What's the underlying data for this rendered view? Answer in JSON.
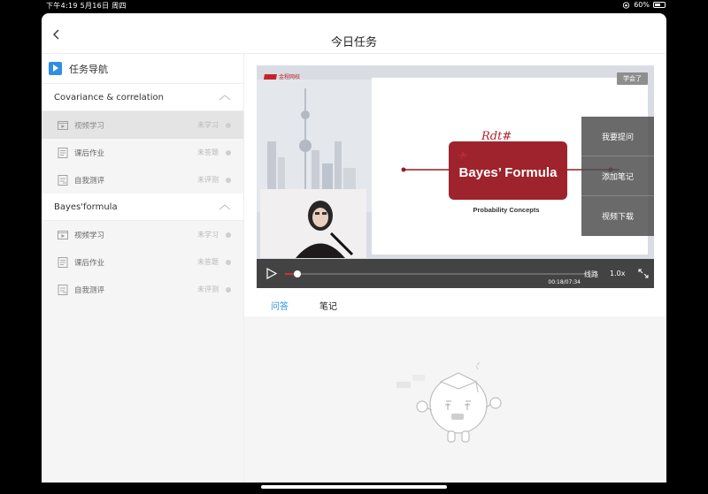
{
  "status_bar": {
    "time_date": "下午4:19   5月16日 周四",
    "battery": "60%",
    "battery_level": 0.6
  },
  "header": {
    "title": "今日任务"
  },
  "nav": {
    "title": "任务导航",
    "sections": [
      {
        "title": "Covariance & correlation",
        "tasks": [
          {
            "label": "视频学习",
            "status": "未学习",
            "icon": "video-icon"
          },
          {
            "label": "课后作业",
            "status": "未答题",
            "icon": "homework-icon"
          },
          {
            "label": "自我测评",
            "status": "未评测",
            "icon": "assessment-icon"
          }
        ]
      },
      {
        "title": "Bayes'formula",
        "tasks": [
          {
            "label": "视频学习",
            "status": "未学习",
            "icon": "video-icon"
          },
          {
            "label": "课后作业",
            "status": "未答题",
            "icon": "homework-icon"
          },
          {
            "label": "自我测评",
            "status": "未评测",
            "icon": "assessment-icon"
          }
        ]
      }
    ]
  },
  "video": {
    "logo_text": "金程网校",
    "logo_sub": "www.gfedu.net",
    "learned_label": "学会了",
    "slide_title": "Bayes’ Formula",
    "slide_subtitle": "Probability Concepts",
    "handwriting": "Rdt#",
    "menu": [
      "我要提问",
      "添加笔记",
      "视频下载"
    ],
    "time": "00:18/07:34",
    "progress_fraction": 0.04,
    "route_label": "线路",
    "speed_label": "1.0x",
    "accent_color": "#2f8ee6",
    "slide_box_color": "#9e232c"
  },
  "tabs": [
    "问答",
    "笔记"
  ]
}
